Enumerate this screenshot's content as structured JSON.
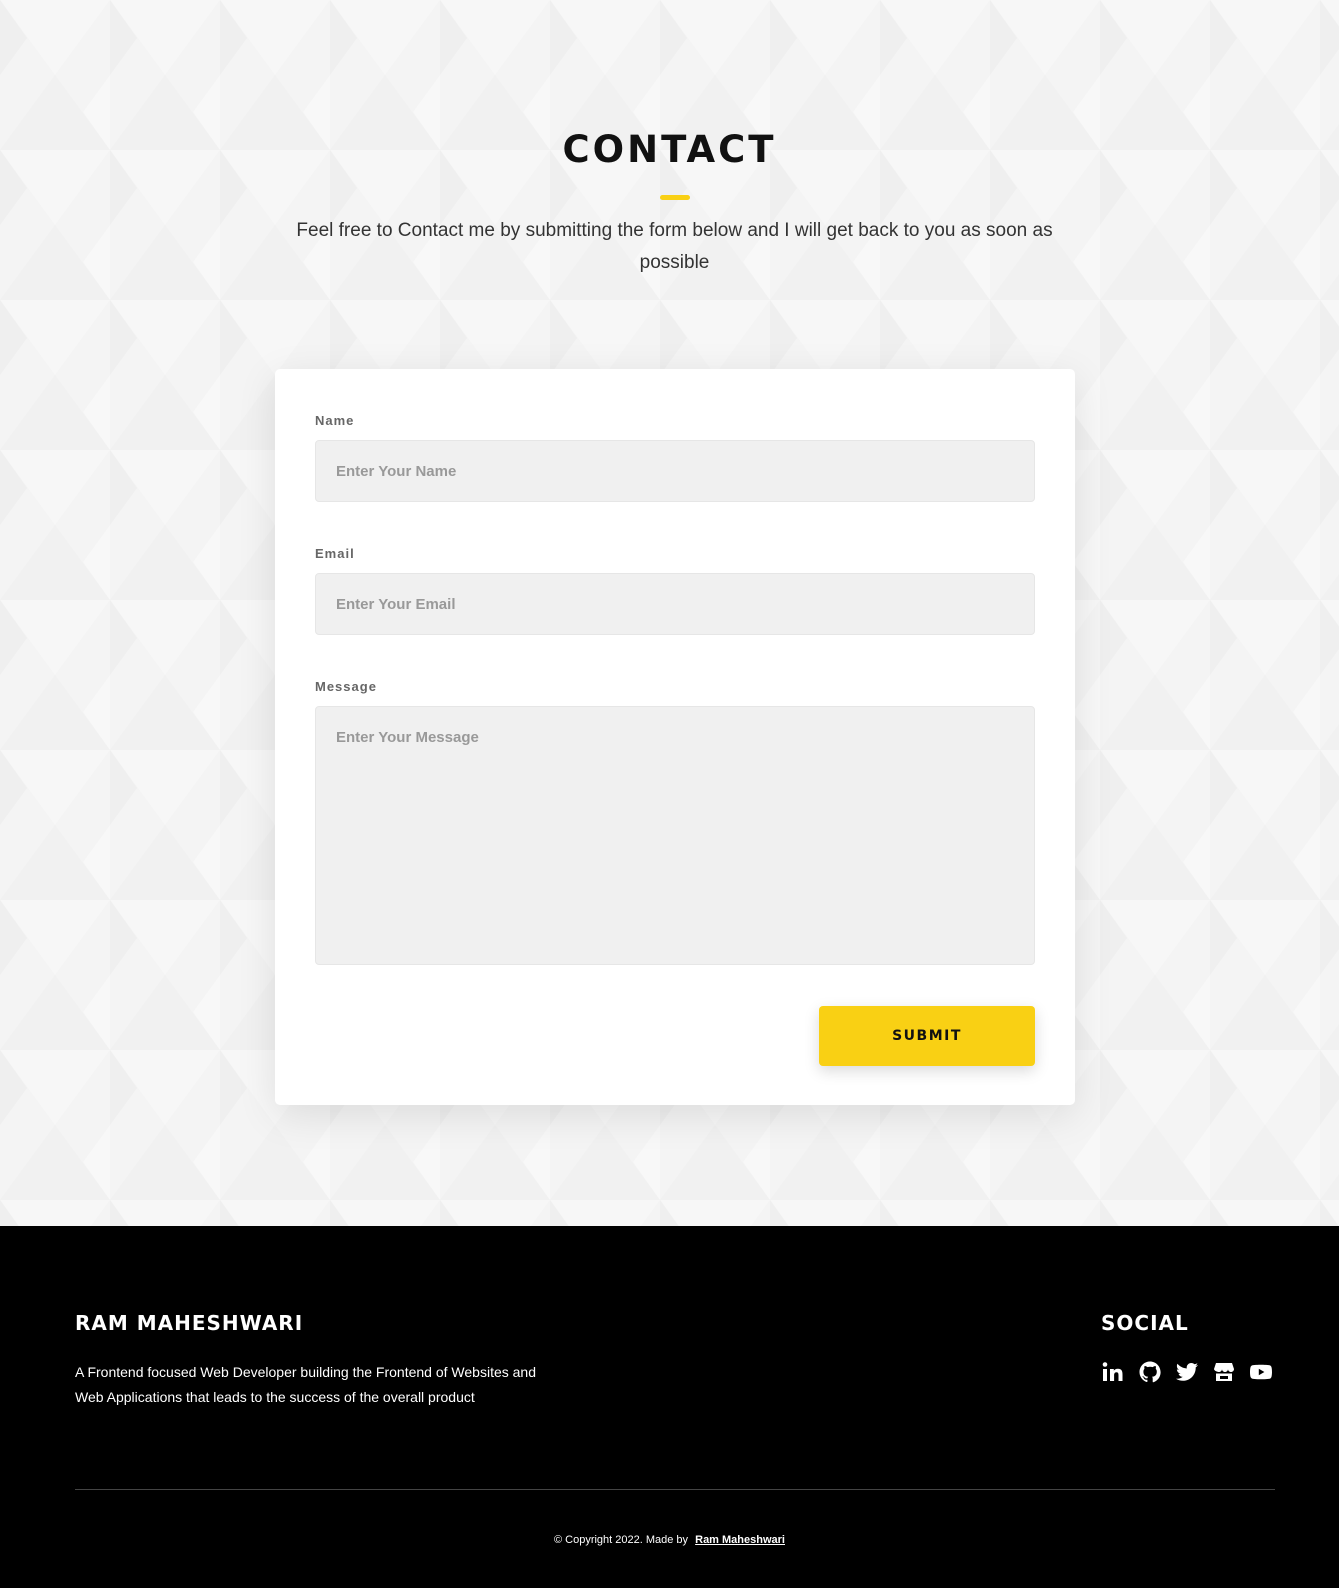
{
  "contact": {
    "title": "CONTACT",
    "subtitle": "Feel free to Contact me by submitting the form below and I will get back to you as soon as possible"
  },
  "form": {
    "name_label": "Name",
    "name_placeholder": "Enter Your Name",
    "name_value": "",
    "email_label": "Email",
    "email_placeholder": "Enter Your Email",
    "email_value": "",
    "message_label": "Message",
    "message_placeholder": "Enter Your Message",
    "message_value": "",
    "submit_label": "SUBMIT"
  },
  "footer": {
    "name": "RAM MAHESHWARI",
    "description": "A Frontend focused Web Developer building the Frontend of Websites and Web Applications that leads to the success of the overall product",
    "social_title": "SOCIAL",
    "social_icons": [
      "linkedin-icon",
      "github-icon",
      "twitter-icon",
      "store-icon",
      "youtube-icon"
    ],
    "copyright_text": "© Copyright 2022. Made by",
    "copyright_link": "Ram Maheshwari"
  },
  "colors": {
    "accent": "#f9d014",
    "section_bg": "#f4f4f4",
    "footer_bg": "#000000",
    "input_bg": "#f0f0f0"
  }
}
